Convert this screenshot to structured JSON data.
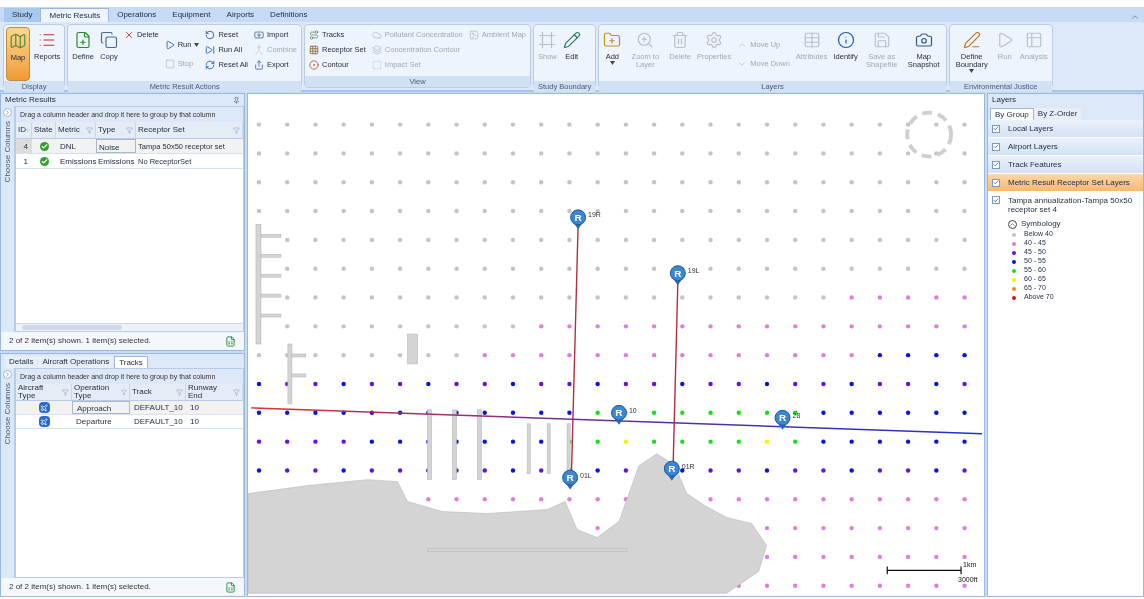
{
  "ribbon": {
    "tabs": [
      {
        "label": "Study",
        "selected": false
      },
      {
        "label": "Metric Results",
        "selected": true
      },
      {
        "label": "Operations",
        "selected": false
      },
      {
        "label": "Equipment",
        "selected": false
      },
      {
        "label": "Airports",
        "selected": false
      },
      {
        "label": "Definitions",
        "selected": false
      }
    ],
    "groups": [
      {
        "label": "Display",
        "columns": [
          [
            {
              "kind": "large",
              "label": "Map",
              "selected": true,
              "disabled": false
            }
          ],
          [
            {
              "kind": "large",
              "label": "Reports",
              "selected": false,
              "disabled": false
            }
          ]
        ]
      },
      {
        "label": "Metric Result Actions",
        "columns": [
          [
            {
              "kind": "large",
              "label": "Define",
              "selected": false,
              "disabled": false
            }
          ],
          [
            {
              "kind": "large",
              "label": "Copy",
              "selected": false,
              "disabled": false
            }
          ],
          [
            {
              "kind": "small",
              "label": "Delete",
              "selected": false,
              "disabled": false
            }
          ],
          [
            {
              "kind": "small",
              "label": "Run",
              "dropdown": true,
              "selected": false,
              "disabled": false
            },
            {
              "kind": "small",
              "label": "Stop",
              "selected": false,
              "disabled": true
            }
          ],
          [
            {
              "kind": "small",
              "label": "Reset",
              "selected": false,
              "disabled": false
            },
            {
              "kind": "small",
              "label": "Run All",
              "selected": false,
              "disabled": false
            },
            {
              "kind": "small",
              "label": "Reset All",
              "selected": false,
              "disabled": false
            }
          ],
          [
            {
              "kind": "small",
              "label": "Import",
              "selected": false,
              "disabled": false
            },
            {
              "kind": "small",
              "label": "Combine",
              "selected": false,
              "disabled": true
            },
            {
              "kind": "small",
              "label": "Export",
              "selected": false,
              "disabled": false
            }
          ]
        ]
      },
      {
        "label": "View",
        "columns": [
          [
            {
              "kind": "small",
              "label": "Tracks",
              "selected": false,
              "disabled": false
            },
            {
              "kind": "small",
              "label": "Receptor Set",
              "selected": false,
              "disabled": false
            },
            {
              "kind": "small",
              "label": "Contour",
              "selected": false,
              "disabled": false
            }
          ],
          [
            {
              "kind": "small",
              "label": "Pollutant Concentration",
              "selected": false,
              "disabled": true
            },
            {
              "kind": "small",
              "label": "Concentration Contour",
              "selected": false,
              "disabled": true
            },
            {
              "kind": "small",
              "label": "Impact Set",
              "selected": false,
              "disabled": true
            }
          ],
          [
            {
              "kind": "small",
              "label": "Ambient Map",
              "selected": false,
              "disabled": true
            }
          ]
        ]
      },
      {
        "label": "Study Boundary",
        "columns": [
          [
            {
              "kind": "large",
              "label": "Show",
              "selected": false,
              "disabled": true
            }
          ],
          [
            {
              "kind": "large",
              "label": "Edit",
              "selected": false,
              "disabled": false
            }
          ]
        ]
      },
      {
        "label": "Layers",
        "columns": [
          [
            {
              "kind": "large",
              "label": "Add",
              "dropdown": true,
              "selected": false,
              "disabled": false
            }
          ],
          [
            {
              "kind": "large",
              "label": "Zoom to Layer",
              "selected": false,
              "disabled": true
            }
          ],
          [
            {
              "kind": "large",
              "label": "Delete",
              "selected": false,
              "disabled": true
            }
          ],
          [
            {
              "kind": "large",
              "label": "Properties",
              "selected": false,
              "disabled": true
            }
          ],
          [
            {
              "kind": "small",
              "label": "Move Up",
              "selected": false,
              "disabled": true
            },
            {
              "kind": "small",
              "label": "Move Down",
              "selected": false,
              "disabled": true
            }
          ],
          [
            {
              "kind": "large",
              "label": "Attributes",
              "selected": false,
              "disabled": true
            }
          ],
          [
            {
              "kind": "large",
              "label": "Identify",
              "selected": false,
              "disabled": false
            }
          ],
          [
            {
              "kind": "large",
              "label": "Save as Shapefile",
              "selected": false,
              "disabled": true
            }
          ],
          [
            {
              "kind": "large",
              "label": "Map Snapshot",
              "selected": false,
              "disabled": false
            }
          ]
        ]
      },
      {
        "label": "Environmental Justice",
        "columns": [
          [
            {
              "kind": "large",
              "label": "Define Boundary",
              "dropdown": true,
              "selected": false,
              "disabled": false
            }
          ],
          [
            {
              "kind": "large",
              "label": "Run",
              "selected": false,
              "disabled": true
            }
          ],
          [
            {
              "kind": "large",
              "label": "Analysis",
              "selected": false,
              "disabled": true
            }
          ]
        ]
      }
    ]
  },
  "metric_results": {
    "title": "Metric Results",
    "group_hint": "Drag a column header and drop it here to group by that column",
    "side_label": "Choose Columns",
    "columns": [
      "ID",
      "State",
      "Metric",
      "Type",
      "Receptor Set"
    ],
    "rows": [
      {
        "id": "4",
        "completed": true,
        "metric": "DNL",
        "type": "Noise",
        "receptor_set": "Tampa 50x50 receptor set",
        "selected": true
      },
      {
        "id": "1",
        "completed": true,
        "metric": "Emissions",
        "type": "Emissions",
        "receptor_set": "No ReceptorSet",
        "selected": false
      }
    ],
    "status": "2 of 2 item(s) shown. 1 item(s) selected."
  },
  "details": {
    "tabs": [
      {
        "label": "Details",
        "selected": false
      },
      {
        "label": "Aircraft Operations",
        "selected": false
      },
      {
        "label": "Tracks",
        "selected": true
      }
    ],
    "group_hint": "Drag a column header and drop it here to group by that column",
    "side_label": "Choose Columns",
    "columns": [
      "Aircraft Type",
      "Operation Type",
      "Track",
      "Runway End"
    ],
    "rows": [
      {
        "operation_type": "Approach",
        "track": "DEFAULT_10",
        "runway_end": "10",
        "selected": true
      },
      {
        "operation_type": "Departure",
        "track": "DEFAULT_10",
        "runway_end": "10",
        "selected": false
      }
    ],
    "status": "2 of 2 item(s) shown. 1 item(s) selected."
  },
  "map": {
    "runway_ends": [
      {
        "glyph": "R",
        "label": "19R"
      },
      {
        "glyph": "R",
        "label": "19L"
      },
      {
        "glyph": "R",
        "label": "10"
      },
      {
        "glyph": "R",
        "label": "28"
      },
      {
        "glyph": "R",
        "label": "01L"
      },
      {
        "glyph": "R",
        "label": "01R"
      }
    ],
    "scale": {
      "metric": "1km",
      "imperial": "3000ft"
    }
  },
  "layers": {
    "title": "Layers",
    "tabs": [
      {
        "label": "By Group",
        "selected": true
      },
      {
        "label": "By Z-Order",
        "selected": false
      }
    ],
    "groups": [
      {
        "label": "Local Layers",
        "checked": true,
        "selected": false
      },
      {
        "label": "Airport Layers",
        "checked": true,
        "selected": false
      },
      {
        "label": "Track Features",
        "checked": true,
        "selected": false
      },
      {
        "label": "Metric Result Receptor Set Layers",
        "checked": true,
        "selected": true
      }
    ],
    "layer": {
      "label": "Tampa annualization-Tampa 50x50 receptor set 4",
      "checked": true
    },
    "symbology": {
      "label": "Symbology",
      "expanded": true,
      "legend": [
        {
          "label": "Below 40",
          "color": "#c4c4c4"
        },
        {
          "label": "40 - 45",
          "color": "#e07ee0"
        },
        {
          "label": "45 - 50",
          "color": "#6a10d8"
        },
        {
          "label": "50 - 55",
          "color": "#0a14dc"
        },
        {
          "label": "55 - 60",
          "color": "#18e018"
        },
        {
          "label": "60 - 65",
          "color": "#f4f400"
        },
        {
          "label": "65 - 70",
          "color": "#f88a10"
        },
        {
          "label": "Above 70",
          "color": "#e01010"
        }
      ]
    }
  }
}
